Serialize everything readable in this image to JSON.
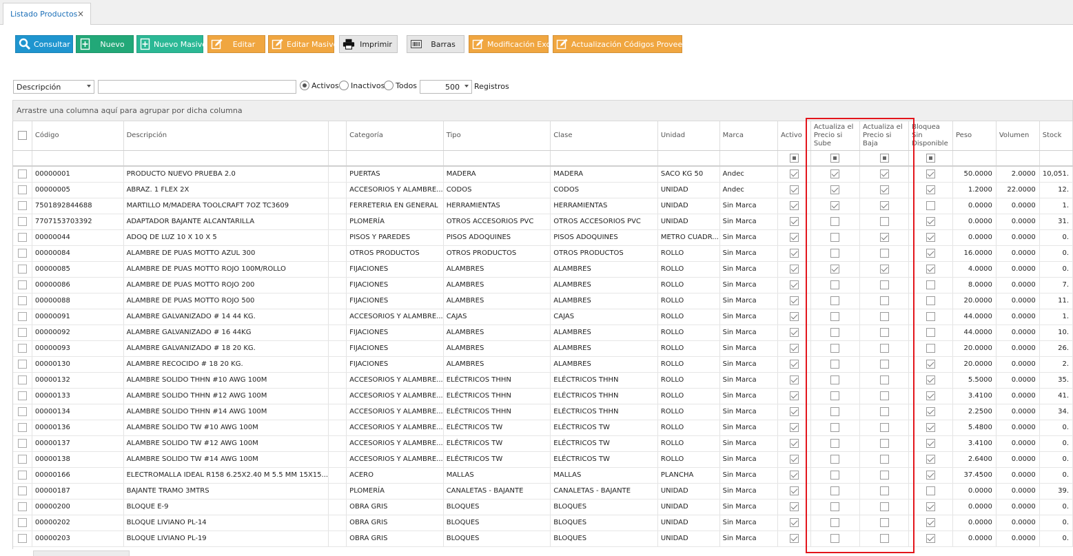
{
  "tab": {
    "title": "Listado Productos",
    "close": "×"
  },
  "toolbar": {
    "consultar": "Consultar",
    "nuevo": "Nuevo",
    "nuevo_masivo": "Nuevo Masivo",
    "editar": "Editar",
    "editar_masivo": "Editar Masivo",
    "imprimir": "Imprimir",
    "barras": "Barras",
    "modificacion_excel": "Modificación Excel",
    "actualizacion_codigos": "Actualización Códigos Proveedor"
  },
  "filters": {
    "field_select": "Descripción",
    "search_value": "",
    "radio_activos": "Activos",
    "radio_inactivos": "Inactivos",
    "radio_todos": "Todos",
    "selected_radio": "Activos",
    "records_select": "500",
    "records_label": "Registros"
  },
  "group_hint": "Arrastre una columna aquí para agrupar por dicha columna",
  "columns": {
    "codigo": "Código",
    "descripcion": "Descripción",
    "categoria": "Categoría",
    "tipo": "Tipo",
    "clase": "Clase",
    "unidad": "Unidad",
    "marca": "Marca",
    "activo": "Activo",
    "act_sube": "Actualiza el Precio si Sube",
    "act_baja": "Actualiza el Precio si Baja",
    "bloquea": "Bloquea Sin Disponible",
    "peso": "Peso",
    "volumen": "Volumen",
    "stock": "Stock"
  },
  "rows": [
    {
      "codigo": "00000001",
      "descripcion": "PRODUCTO NUEVO PRUEBA 2.0",
      "categoria": "PUERTAS",
      "tipo": "MADERA",
      "clase": "MADERA",
      "unidad": "SACO KG 50",
      "marca": "Andec",
      "activo": true,
      "sube": true,
      "baja": true,
      "bloquea": true,
      "peso": "50.0000",
      "volumen": "2.0000",
      "stock": "10,051."
    },
    {
      "codigo": "00000005",
      "descripcion": "ABRAZ. 1 FLEX  2X",
      "categoria": "ACCESORIOS Y ALAMBRE...",
      "tipo": "CODOS",
      "clase": "CODOS",
      "unidad": "UNIDAD",
      "marca": "Andec",
      "activo": true,
      "sube": true,
      "baja": true,
      "bloquea": true,
      "peso": "1.2000",
      "volumen": "22.0000",
      "stock": "12."
    },
    {
      "codigo": "7501892844688",
      "descripcion": "MARTILLO M/MADERA TOOLCRAFT 7OZ TC3609",
      "categoria": "FERRETERIA EN GENERAL",
      "tipo": "HERRAMIENTAS",
      "clase": "HERRAMIENTAS",
      "unidad": "UNIDAD",
      "marca": "Sin Marca",
      "activo": true,
      "sube": true,
      "baja": true,
      "bloquea": false,
      "peso": "0.0000",
      "volumen": "0.0000",
      "stock": "1."
    },
    {
      "codigo": "7707153703392",
      "descripcion": "ADAPTADOR BAJANTE ALCANTARILLA",
      "categoria": "PLOMERÍA",
      "tipo": "OTROS ACCESORIOS PVC",
      "clase": "OTROS ACCESORIOS PVC",
      "unidad": "UNIDAD",
      "marca": "Sin Marca",
      "activo": true,
      "sube": false,
      "baja": false,
      "bloquea": true,
      "peso": "0.0000",
      "volumen": "0.0000",
      "stock": "31."
    },
    {
      "codigo": "00000044",
      "descripcion": "ADOQ DE LUZ 10 X 10 X 5",
      "categoria": "PISOS Y PAREDES",
      "tipo": "PISOS ADOQUINES",
      "clase": "PISOS ADOQUINES",
      "unidad": "METRO CUADR...",
      "marca": "Sin Marca",
      "activo": true,
      "sube": false,
      "baja": true,
      "bloquea": true,
      "peso": "0.0000",
      "volumen": "0.0000",
      "stock": "0."
    },
    {
      "codigo": "00000084",
      "descripcion": "ALAMBRE DE PUAS MOTTO AZUL 300",
      "categoria": "OTROS PRODUCTOS",
      "tipo": "OTROS PRODUCTOS",
      "clase": "OTROS PRODUCTOS",
      "unidad": "ROLLO",
      "marca": "Sin Marca",
      "activo": true,
      "sube": false,
      "baja": false,
      "bloquea": true,
      "peso": "16.0000",
      "volumen": "0.0000",
      "stock": "0."
    },
    {
      "codigo": "00000085",
      "descripcion": "ALAMBRE DE PUAS MOTTO ROJO 100M/ROLLO",
      "categoria": "FIJACIONES",
      "tipo": "ALAMBRES",
      "clase": "ALAMBRES",
      "unidad": "ROLLO",
      "marca": "Sin Marca",
      "activo": true,
      "sube": true,
      "baja": true,
      "bloquea": true,
      "peso": "4.0000",
      "volumen": "0.0000",
      "stock": "0."
    },
    {
      "codigo": "00000086",
      "descripcion": "ALAMBRE DE PUAS MOTTO ROJO 200",
      "categoria": "FIJACIONES",
      "tipo": "ALAMBRES",
      "clase": "ALAMBRES",
      "unidad": "ROLLO",
      "marca": "Sin Marca",
      "activo": true,
      "sube": false,
      "baja": false,
      "bloquea": false,
      "peso": "8.0000",
      "volumen": "0.0000",
      "stock": "7."
    },
    {
      "codigo": "00000088",
      "descripcion": "ALAMBRE DE PUAS MOTTO ROJO 500",
      "categoria": "FIJACIONES",
      "tipo": "ALAMBRES",
      "clase": "ALAMBRES",
      "unidad": "ROLLO",
      "marca": "Sin Marca",
      "activo": true,
      "sube": false,
      "baja": false,
      "bloquea": false,
      "peso": "20.0000",
      "volumen": "0.0000",
      "stock": "11."
    },
    {
      "codigo": "00000091",
      "descripcion": "ALAMBRE GALVANIZADO # 14 44 KG.",
      "categoria": "ACCESORIOS Y ALAMBRE...",
      "tipo": "CAJAS",
      "clase": "CAJAS",
      "unidad": "ROLLO",
      "marca": "Sin Marca",
      "activo": true,
      "sube": false,
      "baja": false,
      "bloquea": false,
      "peso": "44.0000",
      "volumen": "0.0000",
      "stock": "1."
    },
    {
      "codigo": "00000092",
      "descripcion": "ALAMBRE GALVANIZADO # 16 44KG",
      "categoria": "FIJACIONES",
      "tipo": "ALAMBRES",
      "clase": "ALAMBRES",
      "unidad": "ROLLO",
      "marca": "Sin Marca",
      "activo": true,
      "sube": false,
      "baja": false,
      "bloquea": false,
      "peso": "44.0000",
      "volumen": "0.0000",
      "stock": "10."
    },
    {
      "codigo": "00000093",
      "descripcion": "ALAMBRE GALVANIZADO # 18 20 KG.",
      "categoria": "FIJACIONES",
      "tipo": "ALAMBRES",
      "clase": "ALAMBRES",
      "unidad": "ROLLO",
      "marca": "Sin Marca",
      "activo": true,
      "sube": false,
      "baja": false,
      "bloquea": false,
      "peso": "20.0000",
      "volumen": "0.0000",
      "stock": "26."
    },
    {
      "codigo": "00000130",
      "descripcion": "ALAMBRE RECOCIDO # 18 20 KG.",
      "categoria": "FIJACIONES",
      "tipo": "ALAMBRES",
      "clase": "ALAMBRES",
      "unidad": "ROLLO",
      "marca": "Sin Marca",
      "activo": true,
      "sube": false,
      "baja": false,
      "bloquea": true,
      "peso": "20.0000",
      "volumen": "0.0000",
      "stock": "2."
    },
    {
      "codigo": "00000132",
      "descripcion": "ALAMBRE SOLIDO THHN #10 AWG 100M",
      "categoria": "ACCESORIOS Y ALAMBRE...",
      "tipo": "ELÉCTRICOS THHN",
      "clase": "ELÉCTRICOS THHN",
      "unidad": "ROLLO",
      "marca": "Sin Marca",
      "activo": true,
      "sube": false,
      "baja": false,
      "bloquea": true,
      "peso": "5.5000",
      "volumen": "0.0000",
      "stock": "35."
    },
    {
      "codigo": "00000133",
      "descripcion": "ALAMBRE SOLIDO THHN #12 AWG 100M",
      "categoria": "ACCESORIOS Y ALAMBRE...",
      "tipo": "ELÉCTRICOS THHN",
      "clase": "ELÉCTRICOS THHN",
      "unidad": "ROLLO",
      "marca": "Sin Marca",
      "activo": true,
      "sube": false,
      "baja": false,
      "bloquea": true,
      "peso": "3.4100",
      "volumen": "0.0000",
      "stock": "41."
    },
    {
      "codigo": "00000134",
      "descripcion": "ALAMBRE SOLIDO THHN #14 AWG 100M",
      "categoria": "ACCESORIOS Y ALAMBRE...",
      "tipo": "ELÉCTRICOS THHN",
      "clase": "ELÉCTRICOS THHN",
      "unidad": "ROLLO",
      "marca": "Sin Marca",
      "activo": true,
      "sube": false,
      "baja": false,
      "bloquea": true,
      "peso": "2.2500",
      "volumen": "0.0000",
      "stock": "34."
    },
    {
      "codigo": "00000136",
      "descripcion": "ALAMBRE SOLIDO TW #10 AWG 100M",
      "categoria": "ACCESORIOS Y ALAMBRE...",
      "tipo": "ELÉCTRICOS TW",
      "clase": "ELÉCTRICOS TW",
      "unidad": "ROLLO",
      "marca": "Sin Marca",
      "activo": true,
      "sube": false,
      "baja": false,
      "bloquea": true,
      "peso": "5.4800",
      "volumen": "0.0000",
      "stock": "0."
    },
    {
      "codigo": "00000137",
      "descripcion": "ALAMBRE SOLIDO TW #12 AWG 100M",
      "categoria": "ACCESORIOS Y ALAMBRE...",
      "tipo": "ELÉCTRICOS TW",
      "clase": "ELÉCTRICOS TW",
      "unidad": "ROLLO",
      "marca": "Sin Marca",
      "activo": true,
      "sube": false,
      "baja": false,
      "bloquea": true,
      "peso": "3.4100",
      "volumen": "0.0000",
      "stock": "0."
    },
    {
      "codigo": "00000138",
      "descripcion": "ALAMBRE SOLIDO TW #14 AWG 100M",
      "categoria": "ACCESORIOS Y ALAMBRE...",
      "tipo": "ELÉCTRICOS TW",
      "clase": "ELÉCTRICOS TW",
      "unidad": "ROLLO",
      "marca": "Sin Marca",
      "activo": true,
      "sube": false,
      "baja": false,
      "bloquea": true,
      "peso": "2.6400",
      "volumen": "0.0000",
      "stock": "0."
    },
    {
      "codigo": "00000166",
      "descripcion": "ELECTROMALLA IDEAL R158 6.25X2.40 M 5.5 MM 15X15...",
      "categoria": "ACERO",
      "tipo": "MALLAS",
      "clase": "MALLAS",
      "unidad": "PLANCHA",
      "marca": "Sin Marca",
      "activo": true,
      "sube": false,
      "baja": false,
      "bloquea": true,
      "peso": "37.4500",
      "volumen": "0.0000",
      "stock": "0."
    },
    {
      "codigo": "00000187",
      "descripcion": "BAJANTE TRAMO 3MTRS",
      "categoria": "PLOMERÍA",
      "tipo": "CANALETAS - BAJANTE",
      "clase": "CANALETAS - BAJANTE",
      "unidad": "UNIDAD",
      "marca": "Sin Marca",
      "activo": true,
      "sube": false,
      "baja": false,
      "bloquea": false,
      "peso": "0.0000",
      "volumen": "0.0000",
      "stock": "39."
    },
    {
      "codigo": "00000200",
      "descripcion": "BLOQUE E-9",
      "categoria": "OBRA GRIS",
      "tipo": "BLOQUES",
      "clase": "BLOQUES",
      "unidad": "UNIDAD",
      "marca": "Sin Marca",
      "activo": true,
      "sube": false,
      "baja": false,
      "bloquea": true,
      "peso": "0.0000",
      "volumen": "0.0000",
      "stock": "0."
    },
    {
      "codigo": "00000202",
      "descripcion": "BLOQUE LIVIANO PL-14",
      "categoria": "OBRA GRIS",
      "tipo": "BLOQUES",
      "clase": "BLOQUES",
      "unidad": "UNIDAD",
      "marca": "Sin Marca",
      "activo": true,
      "sube": false,
      "baja": false,
      "bloquea": true,
      "peso": "0.0000",
      "volumen": "0.0000",
      "stock": "0."
    },
    {
      "codigo": "00000203",
      "descripcion": "BLOQUE LIVIANO PL-19",
      "categoria": "OBRA GRIS",
      "tipo": "BLOQUES",
      "clase": "BLOQUES",
      "unidad": "UNIDAD",
      "marca": "Sin Marca",
      "activo": true,
      "sube": false,
      "baja": false,
      "bloquea": true,
      "peso": "0.0000",
      "volumen": "0.0000",
      "stock": "0."
    }
  ],
  "colors": {
    "blue": "#1f95cf",
    "green": "#22a878",
    "teal": "#2bb895",
    "orange": "#f0a640",
    "highlight": "#e3141b"
  },
  "icons": {
    "consultar": "search-icon",
    "nuevo": "new-doc-icon",
    "nuevo_masivo": "new-doc-icon",
    "editar": "edit-icon",
    "editar_masivo": "edit-icon",
    "imprimir": "printer-icon",
    "barras": "barcode-icon",
    "modificacion_excel": "edit-icon",
    "actualizacion_codigos": "edit-icon"
  }
}
